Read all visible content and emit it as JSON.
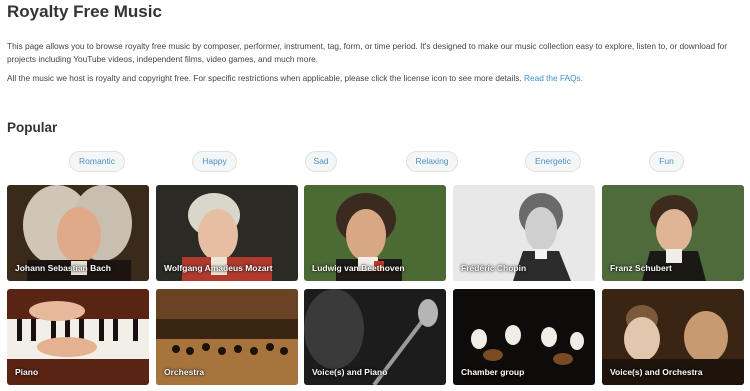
{
  "page": {
    "title": "Royalty Free Music",
    "intro": "This page allows you to browse royalty free music by composer, performer, instrument, tag, form, or time period. It's designed to make our music collection easy to explore, listen to, or download for projects including YouTube videos, independent films, video games, and much more.",
    "license_note": "All the music we host is royalty and copyright free. For specific restrictions when applicable, please click the license icon to see more details.",
    "faq_link": "Read the FAQs."
  },
  "popular": {
    "heading": "Popular",
    "tags": [
      "Romantic",
      "Happy",
      "Sad",
      "Relaxing",
      "Energetic",
      "Fun"
    ]
  },
  "cards": [
    {
      "label": "Johann Sebastian Bach"
    },
    {
      "label": "Wolfgang Amadeus Mozart"
    },
    {
      "label": "Ludwig van Beethoven"
    },
    {
      "label": "Frédéric Chopin"
    },
    {
      "label": "Franz Schubert"
    },
    {
      "label": "Piano"
    },
    {
      "label": "Orchestra"
    },
    {
      "label": "Voice(s) and Piano"
    },
    {
      "label": "Chamber group"
    },
    {
      "label": "Voice(s) and Orchestra"
    }
  ],
  "colors": {
    "link": "#3d8fc9",
    "tag_text": "#4a90c4",
    "tag_bg": "#f5f6f7"
  }
}
